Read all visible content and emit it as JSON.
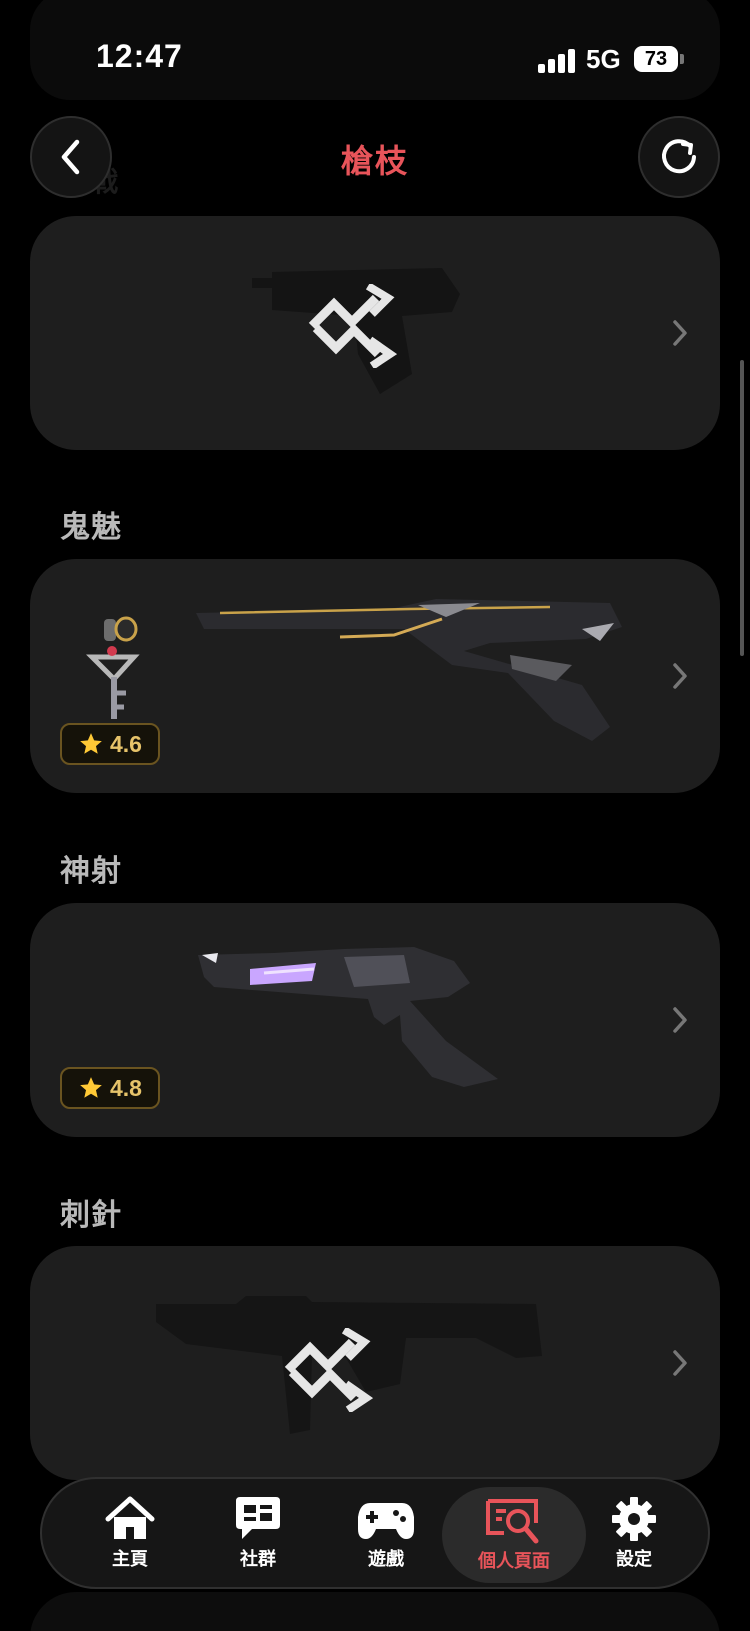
{
  "status_bar": {
    "time": "12:47",
    "network": "5G",
    "battery": "73"
  },
  "header": {
    "title": "槍枝",
    "ghost_label": "近戰"
  },
  "sections": [
    {
      "label": "",
      "rating": null
    },
    {
      "label": "鬼魅",
      "rating": "4.6"
    },
    {
      "label": "神射",
      "rating": "4.8"
    },
    {
      "label": "刺針",
      "rating": null
    }
  ],
  "tabbar": {
    "items": [
      {
        "label": "主頁",
        "icon": "home-icon"
      },
      {
        "label": "社群",
        "icon": "chat-icon"
      },
      {
        "label": "遊戲",
        "icon": "gamepad-icon"
      },
      {
        "label": "個人頁面",
        "icon": "profile-search-icon",
        "active": true
      },
      {
        "label": "設定",
        "icon": "gear-icon"
      }
    ]
  },
  "colors": {
    "accent": "#e8545a",
    "card": "#1e1e1e",
    "rating": "#e6c36a"
  }
}
